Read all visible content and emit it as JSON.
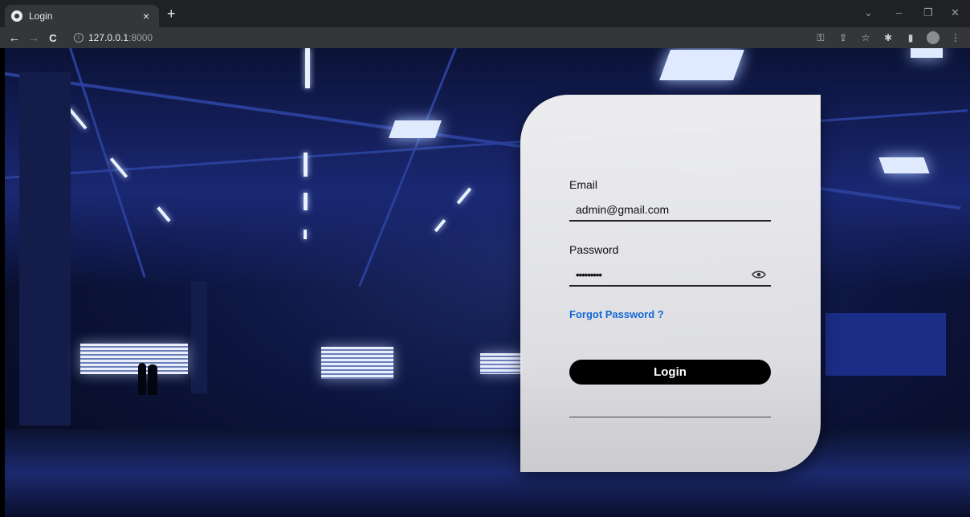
{
  "browser": {
    "tab_title": "Login",
    "tab_close": "×",
    "new_tab": "+",
    "url_host": "127.0.0.1",
    "url_port": ":8000",
    "controls": {
      "menu": "⌄",
      "minimize": "–",
      "restore": "❐",
      "close": "✕"
    },
    "nav": {
      "back": "←",
      "forward": "→",
      "reload": "C"
    },
    "info_icon": "i",
    "toolbar_icons": {
      "key": "⚿",
      "share": "⇪",
      "star": "☆",
      "extensions": "✱",
      "sidepanel": "▮",
      "more": "⋮"
    }
  },
  "login": {
    "email_label": "Email",
    "email_value": "admin@gmail.com",
    "password_label": "Password",
    "password_value": "•••••••••",
    "forgot_label": "Forgot Password ?",
    "login_button": "Login"
  }
}
